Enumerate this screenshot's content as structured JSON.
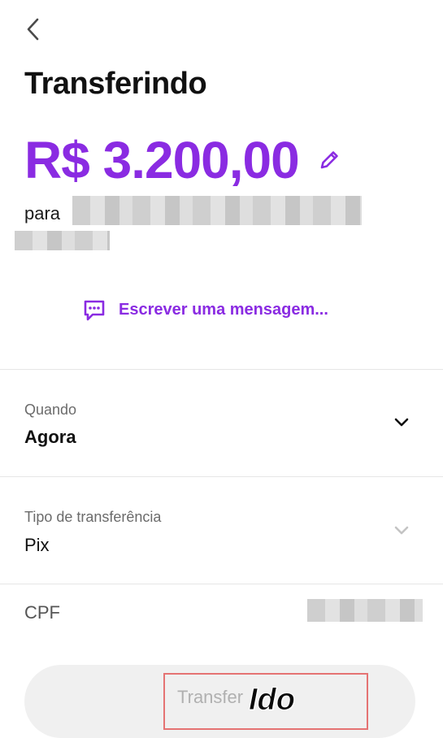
{
  "header": {
    "back_icon": "chevron-left-icon"
  },
  "title": "Transferindo",
  "amount": {
    "value": "R$ 3.200,00",
    "edit_icon": "pencil-icon",
    "color": "#8a2be2"
  },
  "recipient": {
    "prefix": "para"
  },
  "message": {
    "label": "Escrever uma mensagem...",
    "icon": "chat-bubble-icon"
  },
  "when": {
    "label": "Quando",
    "value": "Agora",
    "icon": "chevron-down-icon"
  },
  "type": {
    "label": "Tipo de transferência",
    "value": "Pix",
    "icon": "chevron-down-icon"
  },
  "cpf": {
    "label": "CPF"
  },
  "cta": {
    "label": "Transfer",
    "overlay": "Ido"
  },
  "colors": {
    "accent": "#8a2be2",
    "highlight_border": "#e57373"
  }
}
